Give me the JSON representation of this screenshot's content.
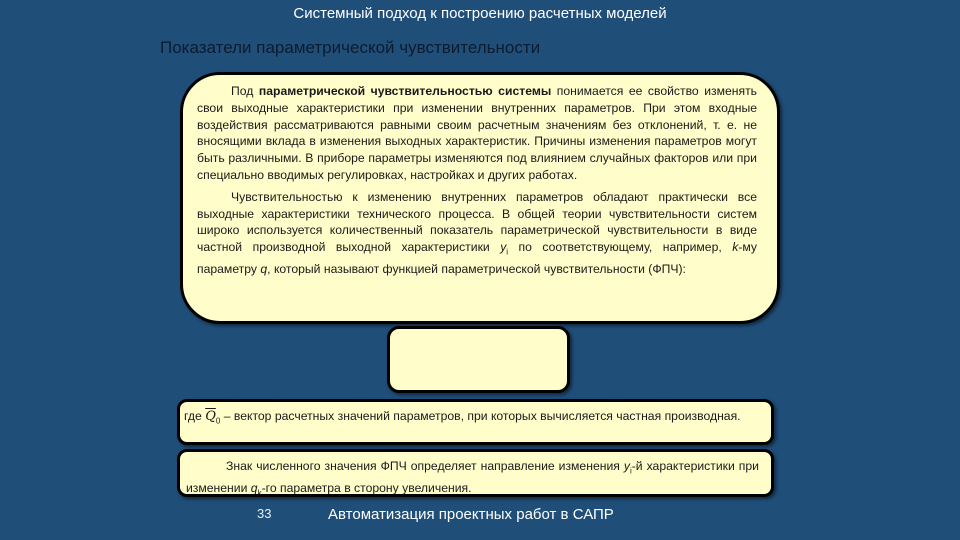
{
  "slide_title": "Системный подход к построению расчетных моделей",
  "heading": "Показатели параметрической чувствительности",
  "main_box": {
    "p1_lead": "Под ",
    "p1_bold": "параметрической чувствительностью системы",
    "p1_rest": " понимается ее свойство изменять свои выходные характеристики при изменении внутренних параметров. При этом входные воздействия рассматриваются равными своим расчетным значениям без отклонений, т. е. не вносящими вклада в изменения выходных характеристик. Причины изменения параметров могут быть различными. В приборе параметры изменяются под влиянием случайных факторов или при специально вводимых регулировках, настройках и других работах.",
    "p2_a": "Чувствительностью к изменению внутренних параметров обладают практически все выходные характеристики технического процесса. В общей теории чувствительности систем широко используется количественный показатель параметрической чувствительности в виде частной производной выходной характеристики ",
    "p2_y": "y",
    "p2_y_sub": "i",
    "p2_b": " по соответствующему, например, ",
    "p2_k": "k",
    "p2_c": "-му параметру ",
    "p2_q": "q",
    "p2_d": ", который называют функцией параметрической чувствительности (ФПЧ):"
  },
  "formula_box": {},
  "where_box": {
    "lead": "где ",
    "symbol": "Q",
    "symbol_sub": "0",
    "rest": " – вектор расчетных значений параметров, при которых вычисляется частная производная."
  },
  "sign_box": {
    "a": "Знак численного значения ФПЧ определяет направление изменения ",
    "y": "y",
    "y_sub": "i",
    "b": "-й характеристики при изменении ",
    "q": "q",
    "q_sub": "k",
    "c": "-го параметра в сторону увеличения."
  },
  "footer": {
    "page_number": "33",
    "text": "Автоматизация проектных работ в САПР"
  }
}
